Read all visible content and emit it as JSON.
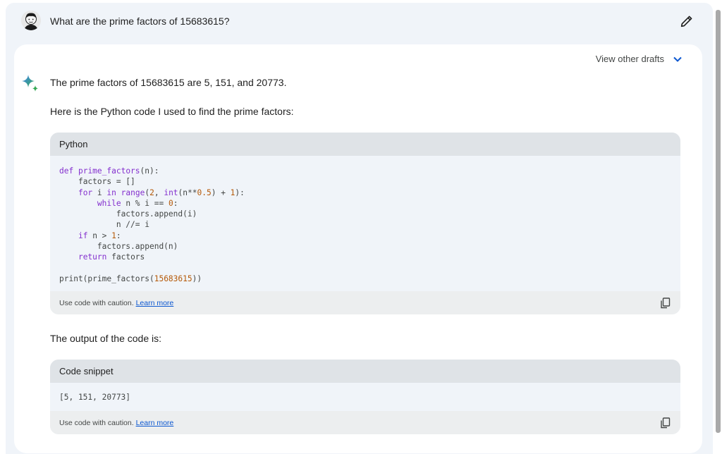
{
  "query": {
    "text": "What are the prime factors of 15683615?"
  },
  "response": {
    "drafts_label": "View other drafts",
    "answer": "The prime factors of 15683615 are 5, 151, and 20773.",
    "intro": "Here is the Python code I used to find the prime factors:",
    "code_block_1": {
      "language": "Python",
      "caution": "Use code with caution.",
      "learn_more": "Learn more"
    },
    "output_intro": "The output of the code is:",
    "code_block_2": {
      "language": "Code snippet",
      "code": "[5, 151, 20773]",
      "caution": "Use code with caution.",
      "learn_more": "Learn more"
    }
  },
  "code_tokens": {
    "l1_kw": "def",
    "l1_fn": "prime_factors",
    "l1_rest": "(n):",
    "l2": "factors = []",
    "l3_kw": "for",
    "l3_a": "i",
    "l3_in": "in",
    "l3_range": "range",
    "l3_b": "(",
    "l3_n2": "2",
    "l3_c": ", ",
    "l3_int": "int",
    "l3_d": "(n**",
    "l3_n05": "0.5",
    "l3_e": ") + ",
    "l3_n1": "1",
    "l3_f": "):",
    "l4_kw": "while",
    "l4_a": "n % i == ",
    "l4_n0": "0",
    "l4_b": ":",
    "l5": "factors.append(i)",
    "l6": "n //= i",
    "l7_kw": "if",
    "l7_a": "n > ",
    "l7_n1": "1",
    "l7_b": ":",
    "l8": "factors.append(n)",
    "l9_kw": "return",
    "l9_a": "factors",
    "l11_a": "print(prime_factors(",
    "l11_num": "15683615",
    "l11_b": "))"
  },
  "colors": {
    "background": "#f0f4f9",
    "card": "#ffffff",
    "code_header": "#dfe3e7",
    "keyword": "#8430ce",
    "number": "#b55908",
    "link": "#0b57d0"
  },
  "icons": {
    "edit": "pencil-icon",
    "drafts": "chevron-down-icon",
    "assistant": "sparkle-icon",
    "copy": "copy-icon"
  }
}
